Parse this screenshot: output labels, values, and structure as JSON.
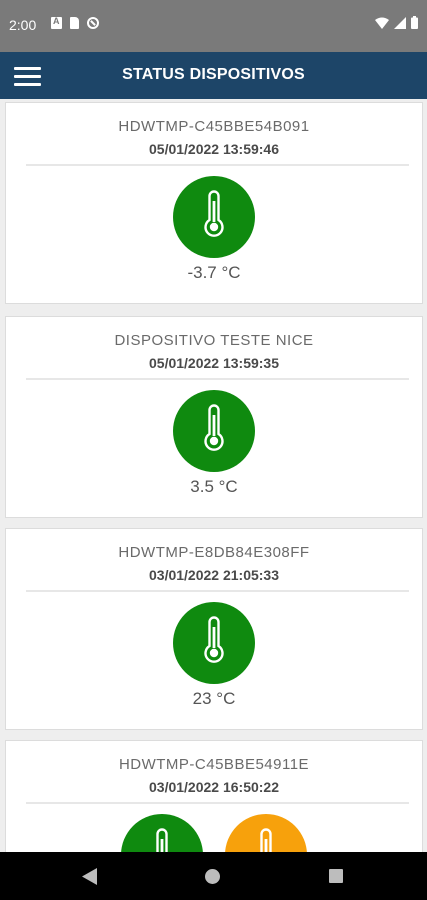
{
  "status_bar": {
    "time": "2:00",
    "left_icons": [
      "notification-a-icon",
      "sd-card-icon",
      "dnd-icon"
    ],
    "right_icons": [
      "wifi-icon",
      "signal-icon",
      "battery-icon"
    ]
  },
  "app_bar": {
    "title": "STATUS DISPOSITIVOS",
    "menu_icon": "hamburger-menu-icon"
  },
  "colors": {
    "app_bar": "#1d4568",
    "status_bar": "#7a7a7a",
    "sensor_ok": "#0f8a0f",
    "sensor_warning": "#f7a10c"
  },
  "devices": [
    {
      "name": "HDWTMP-C45BBE54B091",
      "date": "05/01/2022 13:59:46",
      "temperature": "-3.7 °C",
      "icon": "thermometer-icon"
    },
    {
      "name": "DISPOSITIVO TESTE NICE",
      "date": "05/01/2022 13:59:35",
      "temperature": "3.5 °C",
      "icon": "thermometer-icon"
    },
    {
      "name": "HDWTMP-E8DB84E308FF",
      "date": "03/01/2022 21:05:33",
      "temperature": "23 °C",
      "icon": "thermometer-icon"
    },
    {
      "name": "HDWTMP-C45BBE54911E",
      "date": "03/01/2022 16:50:22",
      "icons": [
        "thermometer-icon",
        "thermometer-icon"
      ]
    }
  ],
  "nav_bar": {
    "icons": [
      "back-icon",
      "home-icon",
      "recents-icon"
    ]
  }
}
